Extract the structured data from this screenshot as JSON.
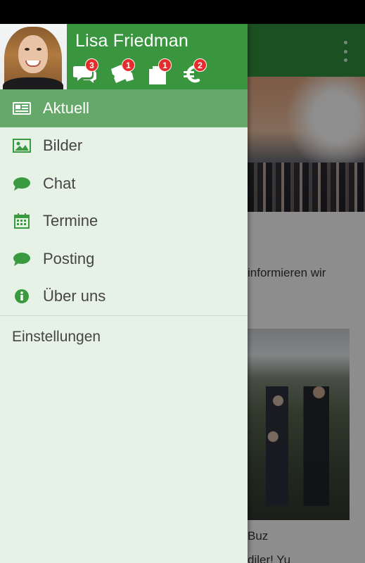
{
  "user": {
    "name": "Lisa Friedman"
  },
  "header_icons": [
    {
      "icon": "chat-bubbles-icon",
      "badge": "3"
    },
    {
      "icon": "tickets-icon",
      "badge": "1"
    },
    {
      "icon": "documents-icon",
      "badge": "1"
    },
    {
      "icon": "euro-icon",
      "badge": "2"
    }
  ],
  "menu": {
    "items": [
      {
        "label": "Aktuell",
        "icon": "newspaper-icon",
        "active": true
      },
      {
        "label": "Bilder",
        "icon": "image-icon",
        "active": false
      },
      {
        "label": "Chat",
        "icon": "chat-bubble-icon",
        "active": false
      },
      {
        "label": "Termine",
        "icon": "calendar-icon",
        "active": false
      },
      {
        "label": "Posting",
        "icon": "chat-bubble-icon",
        "active": false
      },
      {
        "label": "Über uns",
        "icon": "info-icon",
        "active": false
      }
    ],
    "settings_label": "Einstellungen"
  },
  "background": {
    "text_line_1": "informieren wir",
    "text_line_2": "Buz",
    "text_line_3": "diler! Yu"
  },
  "colors": {
    "header_green": "#39963f",
    "toolbar_green": "#2f8a3b",
    "active_item": "#66a86a",
    "drawer_bg": "#e7f2e7",
    "icon_green": "#3a9a3f",
    "badge_red": "#e52b2b"
  }
}
